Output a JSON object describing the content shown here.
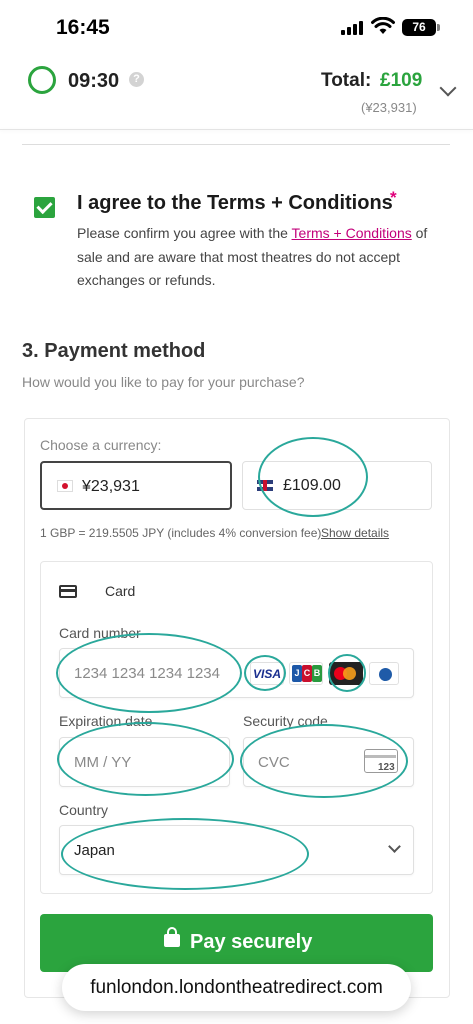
{
  "status_bar": {
    "time": "16:45",
    "battery": "76"
  },
  "header": {
    "timer": "09:30",
    "help": "?",
    "total_label": "Total:",
    "total_value": "£109",
    "total_jpy": "(¥23,931)"
  },
  "terms": {
    "title": "I agree to the Terms + Conditions",
    "required_mark": "*",
    "body_before": "Please confirm you agree with the ",
    "link": "Terms + Conditions",
    "body_after": " of sale and are aware that most theatres do not accept exchanges or refunds."
  },
  "payment": {
    "title": "3. Payment method",
    "subtitle": "How would you like to pay for your purchase?",
    "currency_label": "Choose a currency:",
    "currencies": [
      {
        "code": "JPY",
        "amount": "¥23,931",
        "selected": true
      },
      {
        "code": "GBP",
        "amount": "£109.00",
        "selected": false
      }
    ],
    "rate_note": "1 GBP = 219.5505 JPY (includes 4% conversion fee)",
    "rate_link": "Show details",
    "card": {
      "label": "Card",
      "number_label": "Card number",
      "number_placeholder": "1234 1234 1234 1234",
      "brands": [
        "VISA",
        "JCB",
        "Mastercard",
        "Diners"
      ],
      "visa_text": "VISA",
      "jcb_letters": [
        "J",
        "C",
        "B"
      ],
      "expiry_label": "Expiration date",
      "expiry_placeholder": "MM / YY",
      "cvc_label": "Security code",
      "cvc_placeholder": "CVC",
      "cvc_icon_text": "123",
      "country_label": "Country",
      "country_value": "Japan"
    },
    "pay_button": "Pay securely"
  },
  "browser": {
    "url": "funlondon.londontheatredirect.com"
  },
  "colors": {
    "accent_green": "#2ba43e",
    "link_pink": "#c2007a",
    "annotation_teal": "#2aa89b"
  }
}
